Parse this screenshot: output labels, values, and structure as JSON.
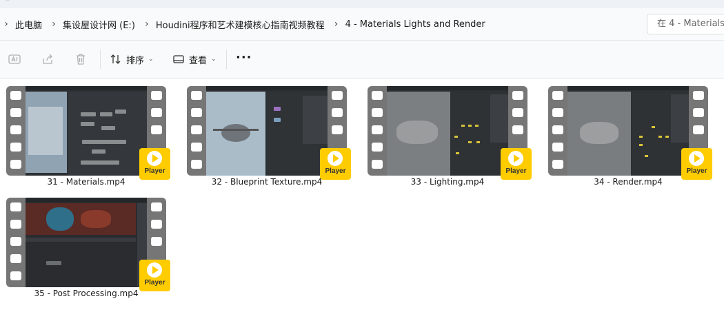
{
  "breadcrumbs": [
    "此电脑",
    "集设屋设计网 (E:)",
    "Houdini程序和艺术建模核心指南视频教程",
    "4 - Materials Lights and Render"
  ],
  "search": {
    "placeholder": "在 4 - Materials"
  },
  "toolbar": {
    "sort_label": "排序",
    "view_label": "查看",
    "more_label": "···",
    "icons": [
      "rename-icon",
      "share-icon",
      "delete-icon",
      "sort-icon",
      "view-icon"
    ]
  },
  "files": [
    {
      "name": "31 - Materials.mp4",
      "badge": "Player"
    },
    {
      "name": "32 - Blueprint Texture.mp4",
      "badge": "Player"
    },
    {
      "name": "33 - Lighting.mp4",
      "badge": "Player"
    },
    {
      "name": "34 - Render.mp4",
      "badge": "Player"
    },
    {
      "name": "35 - Post Processing.mp4",
      "badge": "Player"
    }
  ],
  "colors": {
    "badge": "#ffcc00",
    "film": "#767676",
    "background": "#ffffff",
    "bar": "#f9fafb"
  }
}
